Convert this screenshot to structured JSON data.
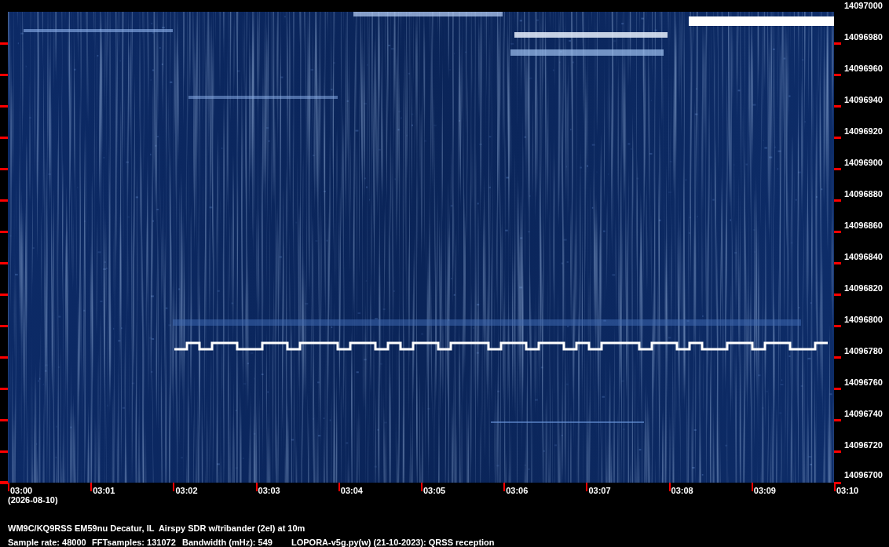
{
  "frequency_axis": {
    "labels": [
      "14097000",
      "14096980",
      "14096960",
      "14096940",
      "14096920",
      "14096900",
      "14096880",
      "14096860",
      "14096840",
      "14096820",
      "14096800",
      "14096780",
      "14096760",
      "14096740",
      "14096720",
      "14096700"
    ]
  },
  "time_axis": {
    "labels": [
      "03:00",
      "03:01",
      "03:02",
      "03:03",
      "03:04",
      "03:05",
      "03:06",
      "03:07",
      "03:08",
      "03:09",
      "03:10"
    ],
    "date": "(2026-08-10)"
  },
  "station": "WM9C/KQ9RSS EM59nu Decatur, IL  Airspy SDR w/tribander (2el) at 10m",
  "parameters": [
    "Sample rate: 48000",
    "FFTsamples: 131072",
    "Bandwidth (mHz): 549",
    "LOPORA-v5g.py(w) (21-10-2023): QRSS reception"
  ]
}
